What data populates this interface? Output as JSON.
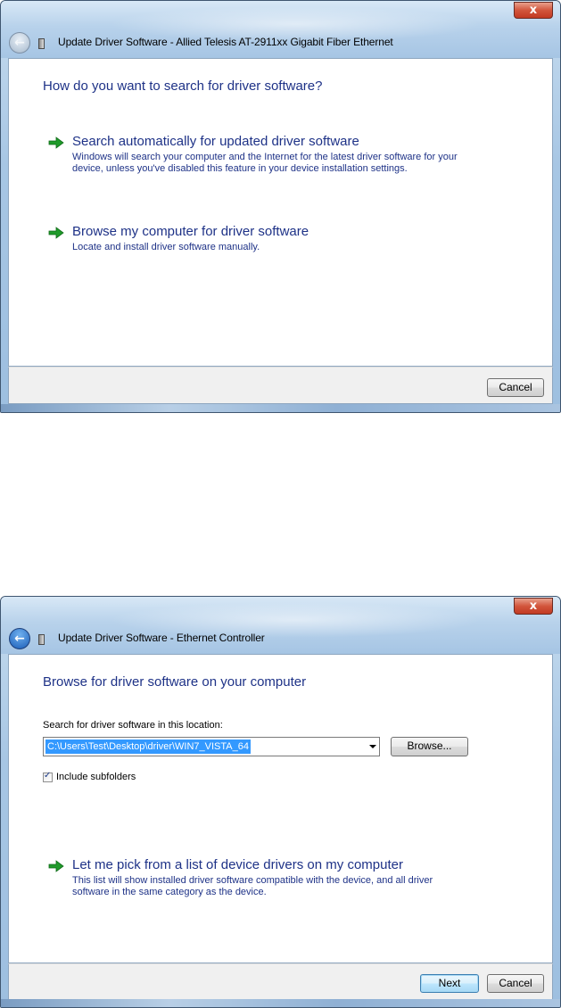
{
  "close_glyph": "x",
  "dialog1": {
    "title": "Update Driver Software - Allied Telesis AT-2911xx Gigabit Fiber Ethernet",
    "heading": "How do you want to search for driver software?",
    "options": [
      {
        "title": "Search automatically for updated driver software",
        "description": "Windows will search your computer and the Internet for the latest driver software for your device, unless you've disabled this feature in your device installation settings."
      },
      {
        "title": "Browse my computer for driver software",
        "description": "Locate and install driver software manually."
      }
    ],
    "cancel_label": "Cancel"
  },
  "dialog2": {
    "title": "Update Driver Software - Ethernet Controller",
    "heading": "Browse for driver software on your computer",
    "search_label": "Search for driver software in this location:",
    "path_value": "C:\\Users\\Test\\Desktop\\driver\\WIN7_VISTA_64",
    "browse_label": "Browse...",
    "include_subfolders_label": "Include subfolders",
    "include_subfolders_checked": true,
    "option": {
      "title": "Let me pick from a list of device drivers on my computer",
      "description": "This list will show installed driver software compatible with the device, and all driver software in the same category as the device."
    },
    "next_label": "Next",
    "cancel_label": "Cancel"
  },
  "colors": {
    "heading_blue": "#1e3287",
    "arrow_green": "#1f9a2a",
    "close_red": "#c23a22"
  },
  "icons": [
    "back-arrow-icon",
    "device-icon",
    "close-icon",
    "green-arrow-icon",
    "dropdown-arrow-icon",
    "checkmark-icon"
  ]
}
